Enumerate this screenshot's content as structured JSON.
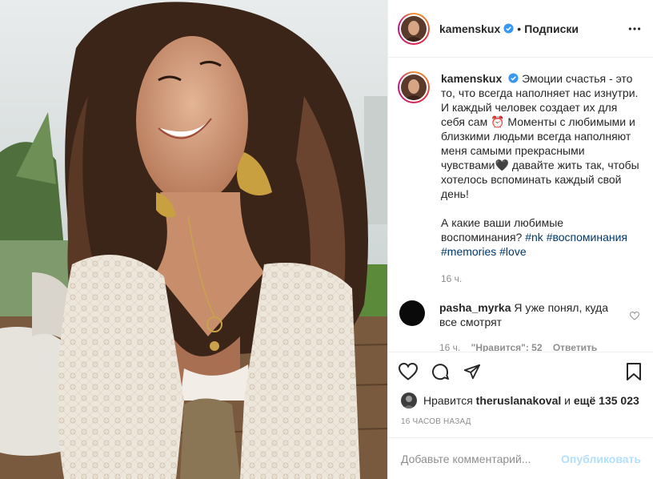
{
  "post": {
    "username": "kamenskux",
    "follow_label": "Подписки",
    "separator": "•"
  },
  "caption": {
    "username": "kamenskux",
    "text_1": "Эмоции счастья - это то, что всегда наполняет нас изнутри. И каждый человек создает их для себя сам ⏰ Моменты с любимыми и близкими людьми всегда наполняют меня самыми прекрасными чувствами🖤 давайте жить так, чтобы хотелось вспоминать каждый свой день!",
    "text_2": "А какие ваши любимые воспоминания?",
    "hashtags": [
      "#nk",
      "#воспоминания",
      "#memories",
      "#love"
    ],
    "age": "16 ч."
  },
  "reply": {
    "username": "pasha_myrka",
    "text": "Я уже понял, куда все смотрят",
    "age": "16 ч.",
    "likes": "\"Нравится\": 52",
    "reply_label": "Ответить"
  },
  "likes": {
    "prefix": "Нравится",
    "user": "theruslanakoval",
    "connector": "и",
    "others": "ещё 135 023"
  },
  "timestamp": "16 ЧАСОВ НАЗАД",
  "comment_box": {
    "placeholder": "Добавьте комментарий...",
    "publish_label": "Опубликовать"
  },
  "icons": {
    "more": "more-horizontal-icon",
    "verified": "verified-badge-icon",
    "like": "heart-icon",
    "comment": "comment-icon",
    "share": "paper-plane-icon",
    "save": "bookmark-icon"
  },
  "colors": {
    "link": "#00376b",
    "verified": "#3897f0",
    "publish_disabled": "#b2dffc",
    "muted": "#8e8e8e"
  }
}
